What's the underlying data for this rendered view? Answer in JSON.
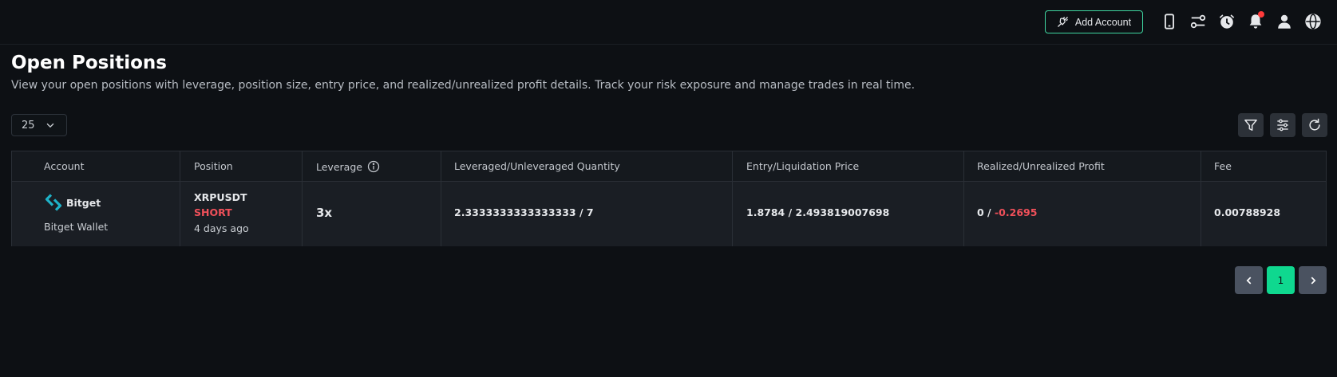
{
  "topbar": {
    "add_account_label": "Add Account",
    "icons": [
      "phone-icon",
      "toggles-icon",
      "alarm-clock-icon",
      "bell-icon",
      "user-icon",
      "globe-icon"
    ]
  },
  "header": {
    "title": "Open Positions",
    "subtitle": "View your open positions with leverage, position size, entry price, and realized/unrealized profit details. Track your risk exposure and manage trades in real time."
  },
  "controls": {
    "page_size": "25"
  },
  "table": {
    "columns": {
      "account": "Account",
      "position": "Position",
      "leverage": "Leverage",
      "quantity": "Leveraged/Unleveraged Quantity",
      "price": "Entry/Liquidation Price",
      "profit": "Realized/Unrealized Profit",
      "fee": "Fee"
    },
    "rows": [
      {
        "exchange": "Bitget",
        "wallet": "Bitget Wallet",
        "symbol": "XRPUSDT",
        "side": "SHORT",
        "age": "4 days ago",
        "leverage": "3x",
        "quantity": "2.3333333333333333 / 7",
        "price": "1.8784 / 2.493819007698",
        "realized": "0",
        "profit_sep": " / ",
        "unrealized": "-0.2695",
        "fee": "0.00788928"
      }
    ]
  },
  "pagination": {
    "current_page": "1"
  },
  "colors": {
    "accent": "#0fd88f",
    "short": "#f0505a",
    "notification": "#ff3b3b"
  }
}
